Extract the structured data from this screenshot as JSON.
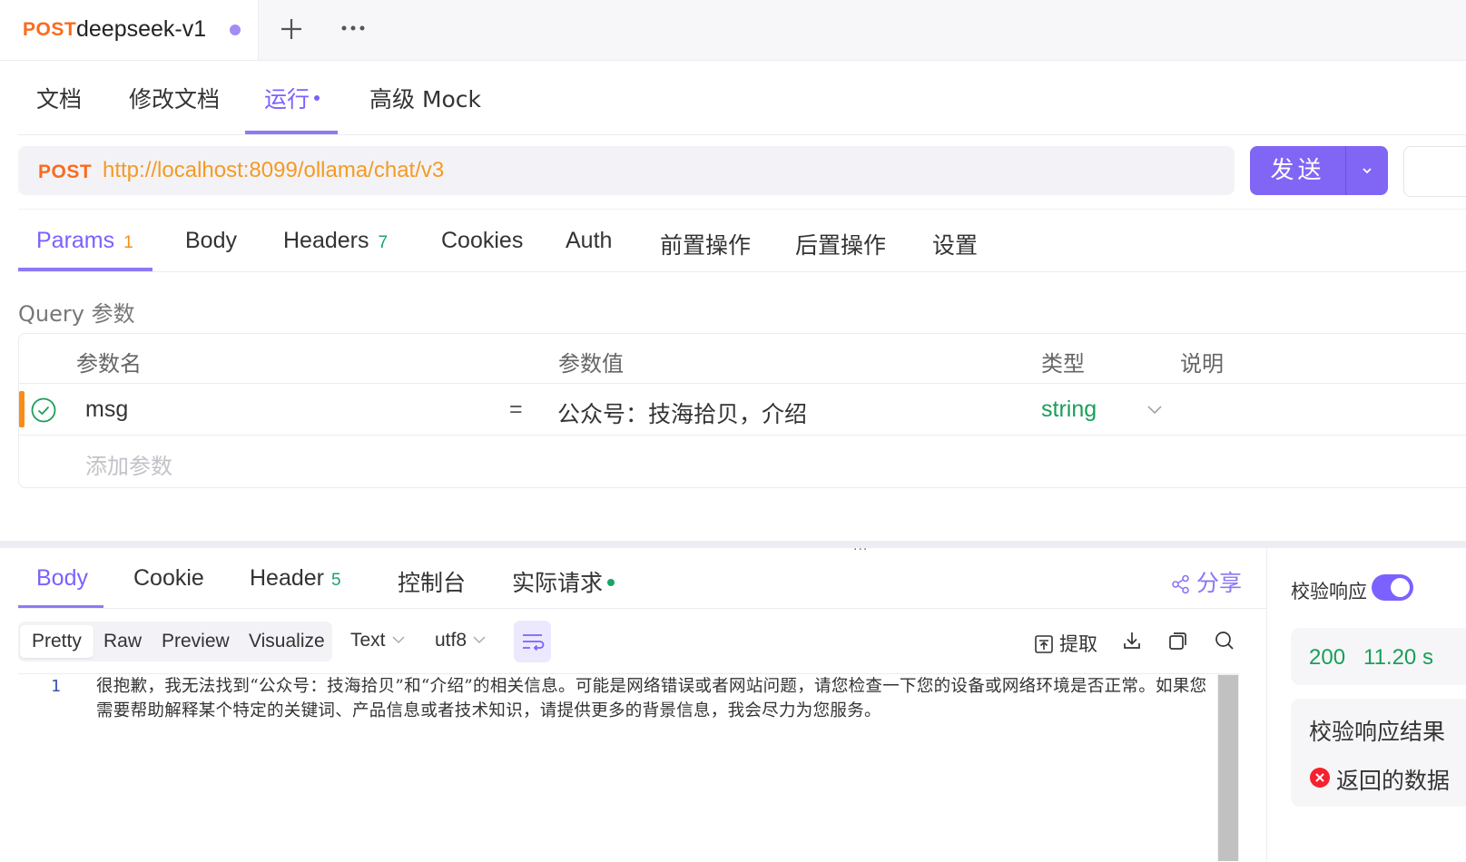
{
  "request_tab": {
    "method": "POST",
    "name": "deepseek-v1"
  },
  "subtabs": [
    "文档",
    "修改文档",
    "运行",
    "高级 Mock"
  ],
  "url_bar": {
    "method": "POST",
    "url": "http://localhost:8099/ollama/chat/v3",
    "send_label": "发送"
  },
  "request_tabs": {
    "params": {
      "label": "Params",
      "count": "1"
    },
    "body": "Body",
    "headers": {
      "label": "Headers",
      "count": "7"
    },
    "cookies": "Cookies",
    "auth": "Auth",
    "pre": "前置操作",
    "post": "后置操作",
    "settings": "设置"
  },
  "query": {
    "title": "Query 参数",
    "headers": [
      "参数名",
      "参数值",
      "类型",
      "说明"
    ],
    "row": {
      "name": "msg",
      "eq": "=",
      "value": "公众号：技海拾贝，介绍",
      "type": "string"
    },
    "add_placeholder": "添加参数"
  },
  "divider_dots": "...",
  "response_tabs": {
    "body": "Body",
    "cookie": "Cookie",
    "header": {
      "label": "Header",
      "count": "5"
    },
    "console": "控制台",
    "actual": "实际请求",
    "share": "分享"
  },
  "format": {
    "modes": [
      "Pretty",
      "Raw",
      "Preview",
      "Visualize"
    ],
    "type": "Text",
    "encoding": "utf8",
    "extract": "提取"
  },
  "editor": {
    "line": "1",
    "text": "很抱歉，我无法找到“公众号：技海拾贝”和“介绍”的相关信息。可能是网络错误或者网站问题，请您检查一下您的设备或网络环境是否正常。如果您需要帮助解释某个特定的关键词、产品信息或者技术知识，请提供更多的背景信息，我会尽力为您服务。"
  },
  "right_panel": {
    "verify_label": "校验响应",
    "status_code": "200",
    "time": "11.20 s",
    "result_title": "校验响应结果",
    "error_text": "返回的数据"
  },
  "colors": {
    "accent": "#7b61ff",
    "method": "#fa6b1d",
    "url": "#f59a23",
    "success": "#1a9e5a",
    "error": "#f5222d"
  }
}
